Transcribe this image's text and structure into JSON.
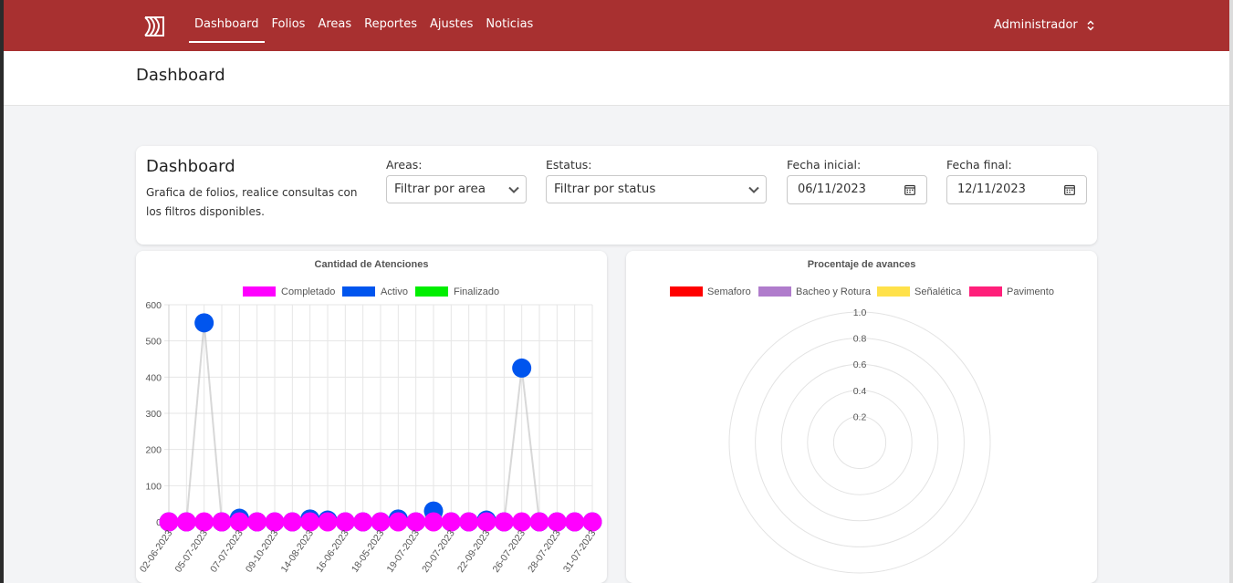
{
  "nav": {
    "items": [
      {
        "label": "Dashboard",
        "active": true
      },
      {
        "label": "Folios"
      },
      {
        "label": "Areas"
      },
      {
        "label": "Reportes"
      },
      {
        "label": "Ajustes"
      },
      {
        "label": "Noticias"
      }
    ],
    "user": "Administrador"
  },
  "header": {
    "title": "Dashboard"
  },
  "filters": {
    "title": "Dashboard",
    "description": "Grafica de folios, realice consultas con los filtros disponibles.",
    "areas_label": "Areas:",
    "areas_value": "Filtrar por area",
    "status_label": "Estatus:",
    "status_value": "Filtrar por status",
    "start_label": "Fecha inicial:",
    "start_value": "06/11/2023",
    "end_label": "Fecha final:",
    "end_value": "12/11/2023"
  },
  "colors": {
    "brand": "#a83030",
    "completado": "#ff00ff",
    "activo": "#0055ee",
    "finalizado": "#00ee00",
    "semaforo": "#ff0000",
    "bacheo": "#b07ccc",
    "senaletica": "#ffe14a",
    "pavimento": "#ff1f7a"
  },
  "chart_data": [
    {
      "type": "line",
      "title": "Cantidad de Atenciones",
      "ylim": [
        0,
        600
      ],
      "yticks": [
        0,
        100,
        200,
        300,
        400,
        500,
        600
      ],
      "grid": true,
      "legend": "top",
      "x": [
        "02-06-2023",
        "",
        "05-07-2023",
        "",
        "07-07-2023",
        "",
        "09-10-2023",
        "",
        "14-08-2023",
        "",
        "16-06-2023",
        "",
        "18-05-2023",
        "",
        "19-07-2023",
        "",
        "20-07-2023",
        "",
        "22-09-2023",
        "",
        "26-07-2023",
        "",
        "28-07-2023",
        "",
        "31-07-2023"
      ],
      "series": [
        {
          "name": "Completado",
          "color": "#ff00ff",
          "values": [
            0,
            0,
            0,
            0,
            0,
            0,
            0,
            0,
            0,
            0,
            0,
            0,
            0,
            0,
            0,
            0,
            0,
            0,
            0,
            0,
            0,
            0,
            0,
            0,
            0
          ]
        },
        {
          "name": "Activo",
          "color": "#0055ee",
          "values": [
            0,
            0,
            550,
            0,
            10,
            0,
            0,
            0,
            8,
            5,
            0,
            0,
            0,
            8,
            0,
            30,
            0,
            0,
            5,
            0,
            425,
            0,
            0,
            0,
            0
          ]
        },
        {
          "name": "Finalizado",
          "color": "#00ee00",
          "values": [
            0,
            0,
            0,
            0,
            0,
            0,
            0,
            0,
            0,
            0,
            0,
            0,
            0,
            0,
            0,
            0,
            0,
            0,
            0,
            0,
            0,
            0,
            0,
            0,
            0
          ]
        }
      ]
    },
    {
      "type": "radar",
      "title": "Procentaje de avances",
      "ylim": [
        0,
        1
      ],
      "ticks": [
        "0.2",
        "0.4",
        "0.6",
        "0.8",
        "1.0"
      ],
      "legend": "top",
      "series": [
        {
          "name": "Semaforo",
          "color": "#ff0000"
        },
        {
          "name": "Bacheo y Rotura",
          "color": "#b07ccc"
        },
        {
          "name": "Señalética",
          "color": "#ffe14a"
        },
        {
          "name": "Pavimento",
          "color": "#ff1f7a"
        }
      ]
    }
  ]
}
